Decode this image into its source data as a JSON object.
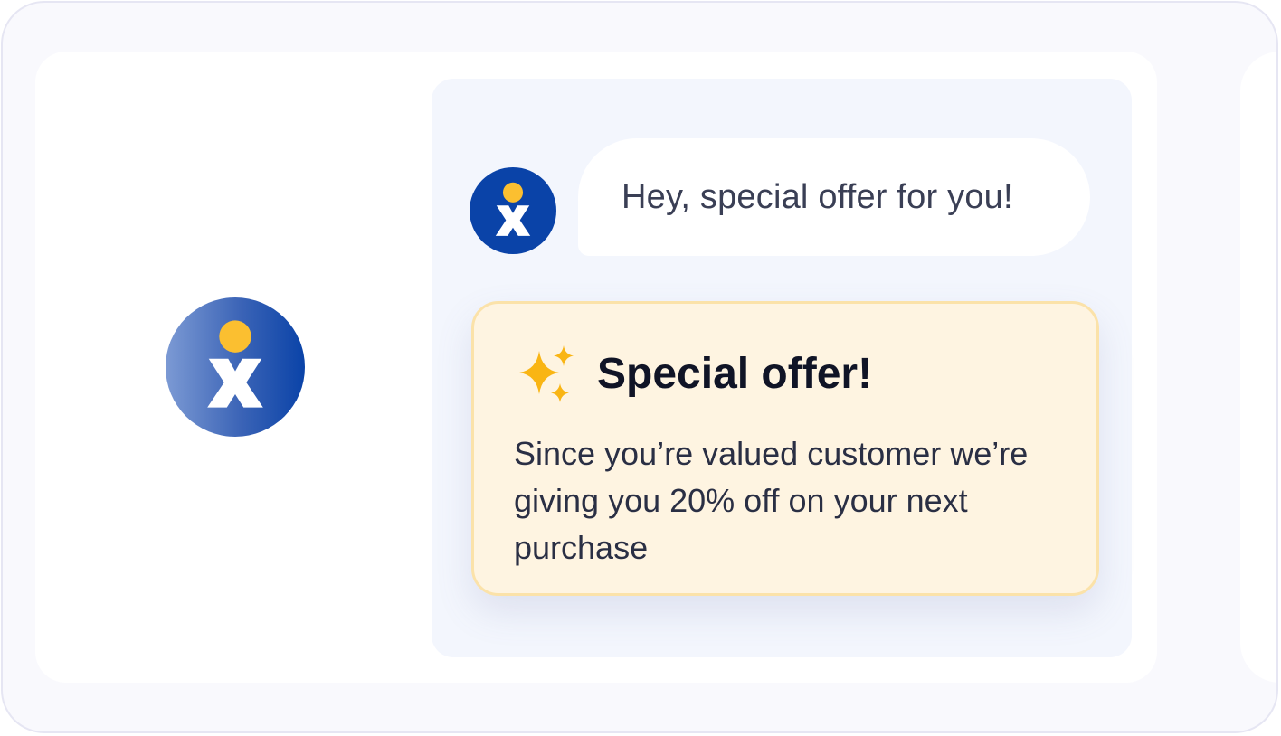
{
  "colors": {
    "brand_blue": "#0a43a8",
    "brand_yellow": "#fbbf30",
    "offer_background": "#fef4e1",
    "chat_background": "#f3f6fd"
  },
  "brand_logo": {
    "icon": "x-person-logo-icon"
  },
  "chat": {
    "avatar_icon": "x-person-logo-icon",
    "message_text": "Hey, special offer for you!"
  },
  "offer": {
    "icon": "sparkles-icon",
    "title": "Special offer!",
    "body": "Since you’re valued customer we’re giving you 20% off on your next purchase"
  }
}
